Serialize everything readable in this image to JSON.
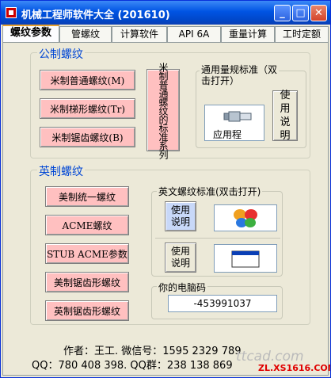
{
  "window": {
    "title": "机械工程师软件大全 (201610)"
  },
  "tabs": [
    "螺纹参数",
    "管螺纹",
    "计算软件",
    "API 6A",
    "重量计算",
    "工时定额"
  ],
  "metric": {
    "title": "公制螺纹",
    "buttons": [
      "米制普通螺纹(M)",
      "米制梯形螺纹(Tr)",
      "米制锯齿螺纹(B)"
    ],
    "series_button": "米制普通螺纹的标准系列",
    "gauge": {
      "label": "通用量规标准（双击打开）",
      "app_caption": "应用程",
      "help_button": "使用说明"
    }
  },
  "imperial": {
    "title": "英制螺纹",
    "buttons": [
      "美制统一螺纹",
      "ACME螺纹",
      "STUB ACME参数",
      "美制锯齿形螺纹",
      "英制锯齿形螺纹"
    ],
    "english_std": {
      "label": "英文螺纹标准(双击打开)",
      "help1": "使用说明",
      "help2": "使用说明"
    },
    "machine": {
      "label": "你的电脑码",
      "value": "-453991037"
    }
  },
  "footer": {
    "line1": "作者：王工. 微信号：1595 2329 789",
    "line2": "QQ：780 408 398. QQ群：238 138 869"
  },
  "watermark": {
    "site": "ttcad.com",
    "url": "ZL.XS1616.COM"
  },
  "icons": {
    "window": "app-icon",
    "minimize": "minimize-icon",
    "maximize": "maximize-icon",
    "close": "close-icon",
    "gauge": "gauge-plug-icon",
    "msn": "butterfly-logo-icon",
    "window_app": "window-app-icon"
  },
  "colors": {
    "accent": "#0054e3",
    "pink_button": "#ffc0c0",
    "group_title": "#0046d5"
  }
}
